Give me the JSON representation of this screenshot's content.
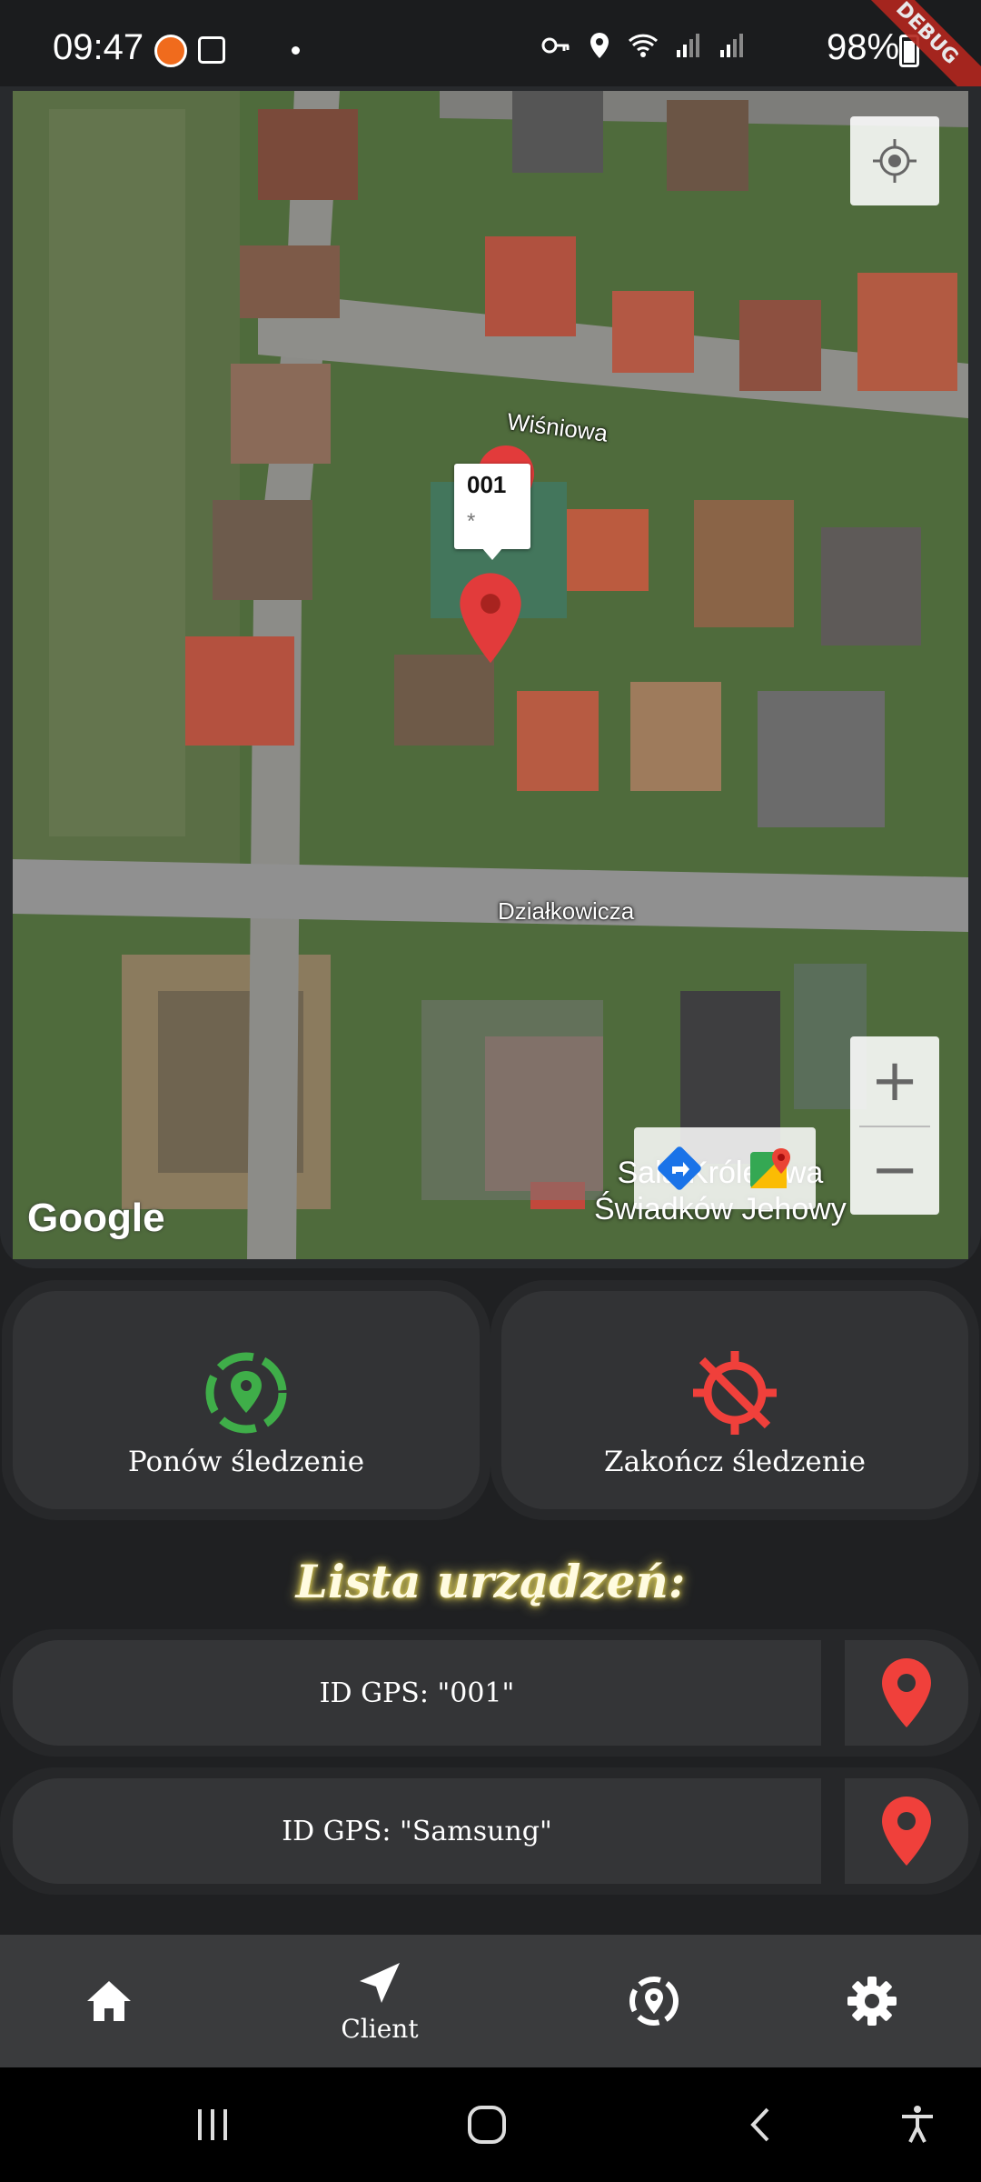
{
  "status_bar": {
    "time": "09:47",
    "battery": "98%",
    "debug_banner": "DEBUG",
    "icons": [
      "key-icon",
      "location-icon",
      "wifi-call-icon",
      "sim1-signal-icon",
      "sim2-signal-icon"
    ]
  },
  "map": {
    "streets": {
      "north": "Wiśniowa",
      "south": "Działkowicza"
    },
    "poi_label_line1": "Sala Królestwa",
    "poi_label_line2": "Świadków Jehowy",
    "provider_logo": "Google",
    "info_window": {
      "title": "001",
      "snippet": "*"
    },
    "zoom_in": "+",
    "zoom_out": "−"
  },
  "actions": {
    "resume_label": "Ponów śledzenie",
    "stop_label": "Zakończ śledzenie",
    "resume_color": "#3fae49",
    "stop_color": "#f0403b"
  },
  "device_list": {
    "title": "Lista urządzeń:",
    "items": [
      {
        "label": "ID GPS: \"001\""
      },
      {
        "label": "ID GPS: \"Samsung\""
      }
    ],
    "pin_color": "#f0403b"
  },
  "bottom_nav": {
    "items": [
      {
        "icon": "home-icon",
        "label": ""
      },
      {
        "icon": "navigation-arrow-icon",
        "label": "Client"
      },
      {
        "icon": "track-location-icon",
        "label": ""
      },
      {
        "icon": "gear-icon",
        "label": ""
      }
    ]
  },
  "system_nav": {
    "icons": [
      "recents-icon",
      "home-circle-icon",
      "back-icon",
      "accessibility-icon"
    ]
  }
}
